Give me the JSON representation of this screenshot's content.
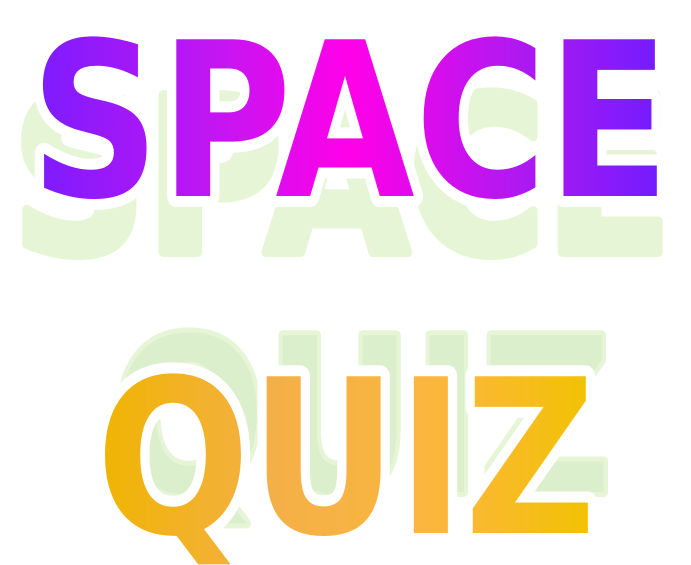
{
  "title": {
    "line1": "SPACE",
    "line2": "QUIZ"
  },
  "colors": {
    "background": "#ffffff",
    "shadow": "#e6f5d6",
    "shadow_quiz": "#dcefcc",
    "outline": "#ffffff",
    "space_gradient": [
      "#7a1cff",
      "#c615f2",
      "#ff00e8",
      "#b418f0",
      "#6e1cff"
    ],
    "quiz_gradient": [
      "#f0b400",
      "#f4b048",
      "#fbb73c",
      "#f2c200"
    ]
  }
}
